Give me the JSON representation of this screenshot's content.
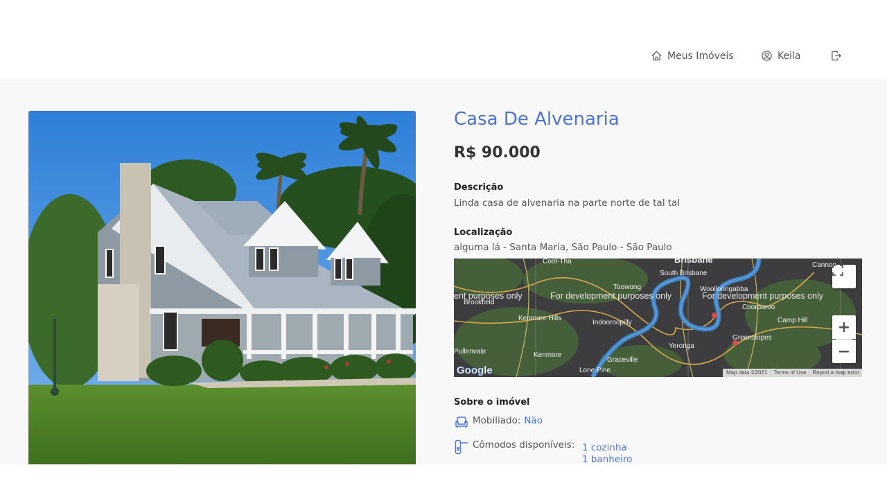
{
  "header": {
    "nav": [
      {
        "label": "Meus Imóveis",
        "icon": "home-icon"
      },
      {
        "label": "Keila",
        "icon": "user-icon"
      },
      {
        "label": "",
        "icon": "logout-icon"
      }
    ]
  },
  "property": {
    "title": "Casa De Alvenaria",
    "price": "R$ 90.000",
    "description_label": "Descrição",
    "description": "Linda casa de alvenaria na parte norte de tal tal",
    "location_label": "Localização",
    "location": "alguma lá - Santa Maria, São Paulo - São Paulo",
    "about_label": "Sobre o imóvel",
    "furnished_label": "Mobiliado:",
    "furnished_value": "Não",
    "rooms_label": "Cômodos disponíveis:",
    "rooms": [
      "1 cozinha",
      "1 banheiro"
    ]
  },
  "map": {
    "watermark": "For development purposes only",
    "watermark_left": "ent purposes only",
    "watermark_right": "For development purposes only",
    "places": [
      "Coot-Tha",
      "Brisbane",
      "South Brisbane",
      "Cannon",
      "Toowong",
      "Woolloongabba",
      "Brookfield",
      "Coorparoo",
      "Kenmore Hills",
      "Indooroopilly",
      "Camp Hill",
      "Yeronga",
      "Greenslopes",
      "Pullenvale",
      "Kenmore",
      "Graceville",
      "Lone Pine"
    ],
    "footer": [
      "Map data ©2021",
      "Terms of Use",
      "Report a map error"
    ],
    "logo": "Google",
    "fullscreen_icon": "fullscreen-icon",
    "zoom_in": "+",
    "zoom_out": "−"
  },
  "colors": {
    "accent": "#4c73d6",
    "map_bg": "#3d3d3f",
    "page_bg": "#f8f8f8"
  }
}
